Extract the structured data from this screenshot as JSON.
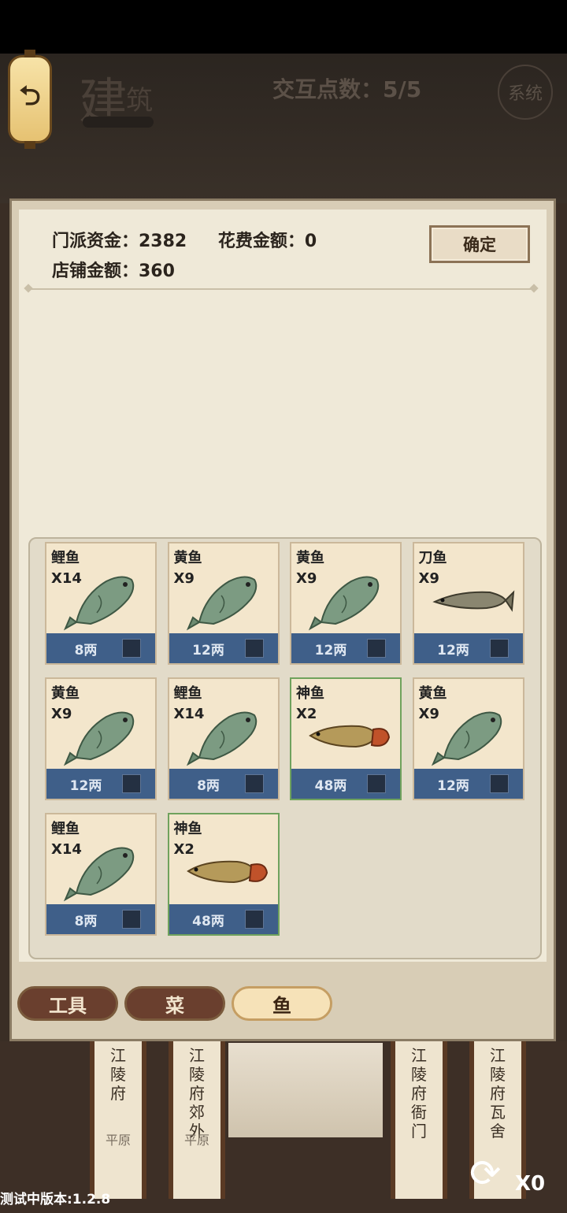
{
  "header": {
    "title_main": "建",
    "title_sub": "筑",
    "interaction_label": "交互点数：5/5",
    "system_label": "系统"
  },
  "info": {
    "funds_label": "门派资金：2382",
    "spend_label": "花费金额：0",
    "shop_label": "店铺金额：360",
    "confirm_label": "确定"
  },
  "items": [
    {
      "name": "鲤鱼",
      "qty": "X14",
      "price": "8两",
      "icon": "carp-fish-icon",
      "rare": false
    },
    {
      "name": "黄鱼",
      "qty": "X9",
      "price": "12两",
      "icon": "carp-fish-icon",
      "rare": false
    },
    {
      "name": "黄鱼",
      "qty": "X9",
      "price": "12两",
      "icon": "carp-fish-icon",
      "rare": false
    },
    {
      "name": "刀鱼",
      "qty": "X9",
      "price": "12两",
      "icon": "knife-fish-icon",
      "rare": false
    },
    {
      "name": "黄鱼",
      "qty": "X9",
      "price": "12两",
      "icon": "carp-fish-icon",
      "rare": false
    },
    {
      "name": "鲤鱼",
      "qty": "X14",
      "price": "8两",
      "icon": "carp-fish-icon",
      "rare": false
    },
    {
      "name": "神鱼",
      "qty": "X2",
      "price": "48两",
      "icon": "arowana-fish-icon",
      "rare": true
    },
    {
      "name": "黄鱼",
      "qty": "X9",
      "price": "12两",
      "icon": "carp-fish-icon",
      "rare": false
    },
    {
      "name": "鲤鱼",
      "qty": "X14",
      "price": "8两",
      "icon": "carp-fish-icon",
      "rare": false
    },
    {
      "name": "神鱼",
      "qty": "X2",
      "price": "48两",
      "icon": "arowana-fish-icon",
      "rare": true
    }
  ],
  "tabs": [
    {
      "label": "工具",
      "active": false
    },
    {
      "label": "菜",
      "active": false
    },
    {
      "label": "鱼",
      "active": true
    }
  ],
  "locations": [
    {
      "name": "江陵府",
      "terrain": "平原"
    },
    {
      "name": "江陵府郊外",
      "terrain": "平原"
    },
    {
      "name": "江陵府衙门",
      "terrain": ""
    },
    {
      "name": "江陵府瓦舍",
      "terrain": ""
    }
  ],
  "footer": {
    "version": "测试中版本:1.2.8",
    "refresh_count": "X0"
  },
  "colors": {
    "card_footer": "#3f5f89",
    "rare_border": "#6fa25d",
    "tab_active": "#f6e2b8",
    "tab_inactive": "#6a3f2e"
  }
}
